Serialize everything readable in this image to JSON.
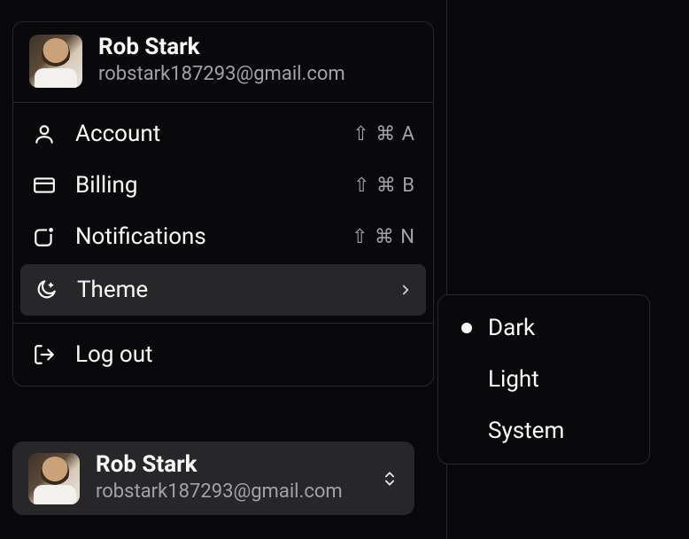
{
  "user": {
    "name": "Rob Stark",
    "email": "robstark187293@gmail.com"
  },
  "menu": {
    "account": {
      "label": "Account",
      "shortcut": "⇧ ⌘ A"
    },
    "billing": {
      "label": "Billing",
      "shortcut": "⇧ ⌘ B"
    },
    "notifications": {
      "label": "Notifications",
      "shortcut": "⇧ ⌘ N"
    },
    "theme": {
      "label": "Theme"
    },
    "logout": {
      "label": "Log out"
    }
  },
  "theme_submenu": {
    "selected": "Dark",
    "options": [
      "Dark",
      "Light",
      "System"
    ]
  }
}
